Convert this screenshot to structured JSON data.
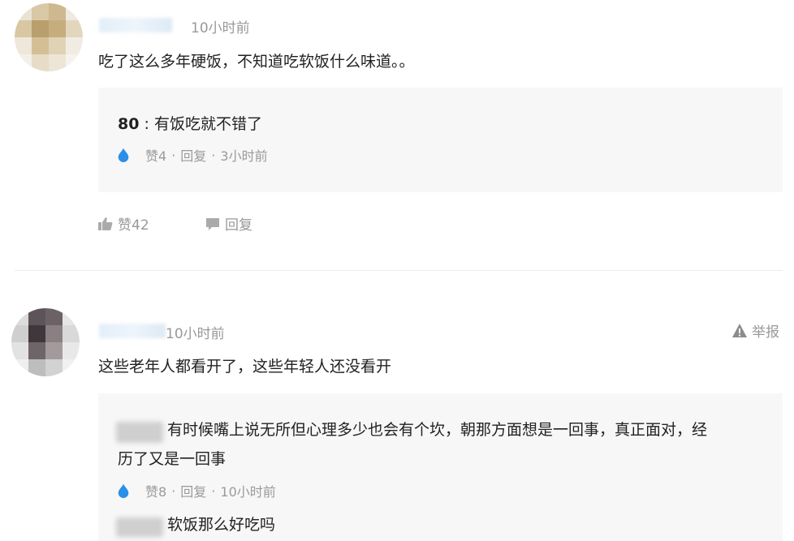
{
  "comments": [
    {
      "time": "10小时前",
      "text": "吃了这么多年硬饭，不知道吃软饭什么味道。。",
      "replies": [
        {
          "author": "80",
          "separator": ":",
          "text": "有饭吃就不错了",
          "likes": "赞4",
          "reply_label": "回复",
          "time": "3小时前",
          "dot1": "·",
          "dot2": "·"
        }
      ],
      "likes": "赞42",
      "reply_label": "回复"
    },
    {
      "time": "10小时前",
      "report_label": "举报",
      "text": "这些老年人都看开了，这些年轻人还没看开",
      "replies": [
        {
          "text_line1": "有时候嘴上说无所但心理多少也会有个坎，朝那方面想是一回事，真正面对，经",
          "text_line2": "历了又是一回事",
          "likes": "赞8",
          "reply_label": "回复",
          "time": "10小时前",
          "dot1": "·",
          "dot2": "·"
        },
        {
          "text": "软饭那么好吃吗"
        }
      ]
    }
  ],
  "colors": {
    "accent_blue": "#2a8fe8",
    "muted": "#999999",
    "reply_bg": "#f7f7f7"
  },
  "icons": {
    "like": "thumbs-up-icon",
    "reply": "speech-bubble-icon",
    "drop": "water-drop-icon",
    "report": "warning-triangle-icon"
  }
}
